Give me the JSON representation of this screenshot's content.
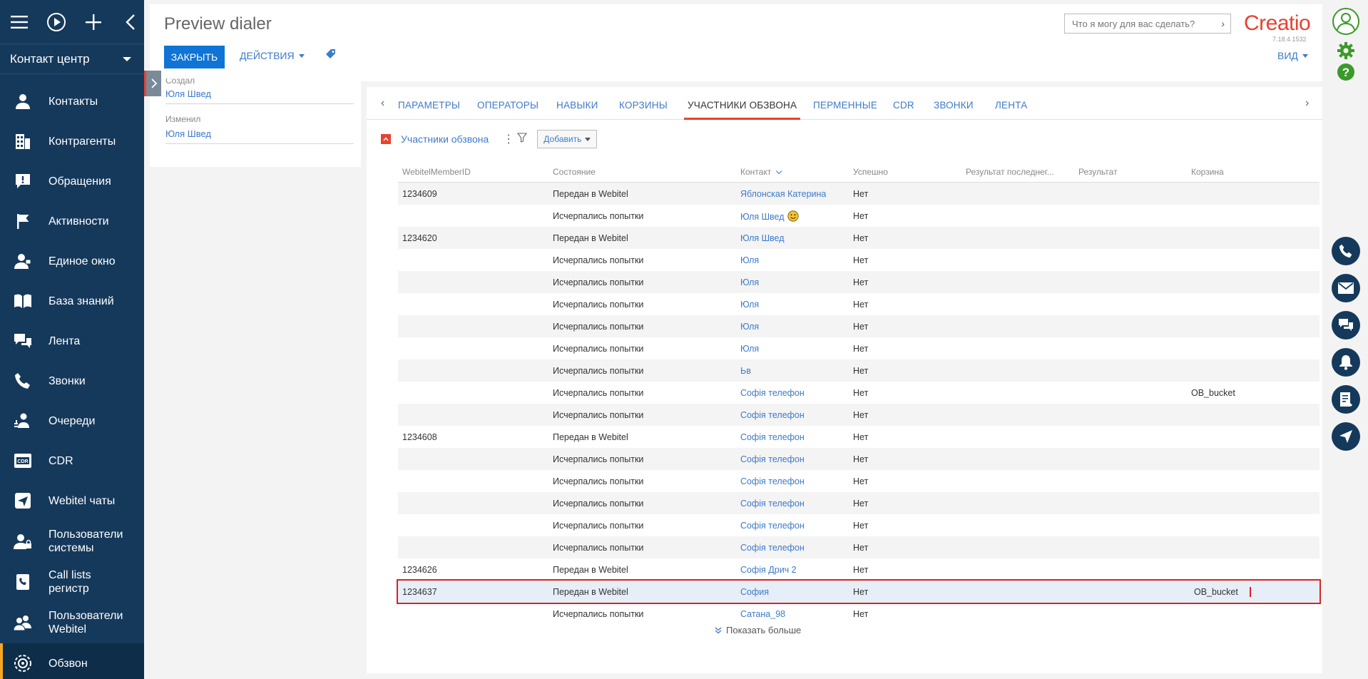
{
  "sidebar": {
    "workplace": "Контакт центр",
    "items": [
      {
        "label": "Контакты",
        "icon": "person-icon"
      },
      {
        "label": "Контрагенты",
        "icon": "building-icon"
      },
      {
        "label": "Обращения",
        "icon": "exclamation-bubble-icon"
      },
      {
        "label": "Активности",
        "icon": "flag-icon"
      },
      {
        "label": "Единое окно",
        "icon": "person-window-icon"
      },
      {
        "label": "База знаний",
        "icon": "book-icon"
      },
      {
        "label": "Лента",
        "icon": "feed-icon"
      },
      {
        "label": "Звонки",
        "icon": "phone-icon"
      },
      {
        "label": "Очереди",
        "icon": "queue-icon"
      },
      {
        "label": "CDR",
        "icon": "cdr-icon"
      },
      {
        "label": "Webitel чаты",
        "icon": "send-icon"
      },
      {
        "label": "Пользователи системы",
        "icon": "user-lock-icon"
      },
      {
        "label": "Call lists регистр",
        "icon": "phonebook-icon"
      },
      {
        "label": "Пользователи Webitel",
        "icon": "users-icon"
      },
      {
        "label": "Обзвон",
        "icon": "dialer-icon"
      }
    ]
  },
  "header": {
    "title": "Preview dialer",
    "close_label": "ЗАКРЫТЬ",
    "actions_label": "ДЕЙСТВИЯ",
    "search_placeholder": "Что я могу для вас сделать?",
    "logo": "Creatio",
    "version": "7.18.4.1532",
    "view_label": "ВИД"
  },
  "info_panel": {
    "fields": [
      {
        "label": "Создал",
        "value": "Юля Швед"
      },
      {
        "label": "Изменил",
        "value": "Юля Швед"
      }
    ]
  },
  "tabs": [
    "ПАРАМЕТРЫ",
    "ОПЕРАТОРЫ",
    "НАВЫКИ",
    "КОРЗИНЫ",
    "УЧАСТНИКИ ОБЗВОНА",
    "ПЕРМЕННЫЕ",
    "CDR",
    "ЗВОНКИ",
    "ЛЕНТА"
  ],
  "active_tab": "УЧАСТНИКИ ОБЗВОНА",
  "detail": {
    "title": "Участники обзвона",
    "add_label": "Добавить",
    "columns": [
      "WebitelMemberID",
      "Состояние",
      "Контакт",
      "Успешно",
      "Результат последнег...",
      "Результат",
      "Корзина"
    ],
    "rows": [
      [
        "1234609",
        "Передан в Webitel",
        "Яблонская Катерина",
        "Нет",
        "",
        "",
        ""
      ],
      [
        "",
        "Исчерпались попытки",
        "Юля Швед",
        "Нет",
        "",
        "",
        ""
      ],
      [
        "1234620",
        "Передан в Webitel",
        "Юля Швед",
        "Нет",
        "",
        "",
        ""
      ],
      [
        "",
        "Исчерпались попытки",
        "Юля",
        "Нет",
        "",
        "",
        ""
      ],
      [
        "",
        "Исчерпались попытки",
        "Юля",
        "Нет",
        "",
        "",
        ""
      ],
      [
        "",
        "Исчерпались попытки",
        "Юля",
        "Нет",
        "",
        "",
        ""
      ],
      [
        "",
        "Исчерпались попытки",
        "Юля",
        "Нет",
        "",
        "",
        ""
      ],
      [
        "",
        "Исчерпались попытки",
        "Юля",
        "Нет",
        "",
        "",
        ""
      ],
      [
        "",
        "Исчерпались попытки",
        "Ьв",
        "Нет",
        "",
        "",
        ""
      ],
      [
        "",
        "Исчерпались попытки",
        "Софія телефон",
        "Нет",
        "",
        "",
        "OB_bucket"
      ],
      [
        "",
        "Исчерпались попытки",
        "Софія телефон",
        "Нет",
        "",
        "",
        ""
      ],
      [
        "1234608",
        "Передан в Webitel",
        "Софія телефон",
        "Нет",
        "",
        "",
        ""
      ],
      [
        "",
        "Исчерпались попытки",
        "Софія телефон",
        "Нет",
        "",
        "",
        ""
      ],
      [
        "",
        "Исчерпались попытки",
        "Софія телефон",
        "Нет",
        "",
        "",
        ""
      ],
      [
        "",
        "Исчерпались попытки",
        "Софія телефон",
        "Нет",
        "",
        "",
        ""
      ],
      [
        "",
        "Исчерпались попытки",
        "Софія телефон",
        "Нет",
        "",
        "",
        ""
      ],
      [
        "",
        "Исчерпались попытки",
        "Софія телефон",
        "Нет",
        "",
        "",
        ""
      ],
      [
        "1234626",
        "Передан в Webitel",
        "Софія Дрич 2",
        "Нет",
        "",
        "",
        ""
      ],
      [
        "1234637",
        "Передан в Webitel",
        "София",
        "Нет",
        "",
        "",
        "OB_bucket"
      ],
      [
        "",
        "Исчерпались попытки",
        "Сатана_98",
        "Нет",
        "",
        "",
        ""
      ]
    ],
    "emoji_row": 1,
    "selected_row": 18,
    "show_more": "Показать больше"
  },
  "colors": {
    "sidebar_bg": "#15395b",
    "accent_blue": "#0f74d6",
    "link": "#3d7bc9",
    "brand_red": "#e8422e",
    "highlight": "#e02020",
    "settings_green": "#3a9a2a"
  }
}
